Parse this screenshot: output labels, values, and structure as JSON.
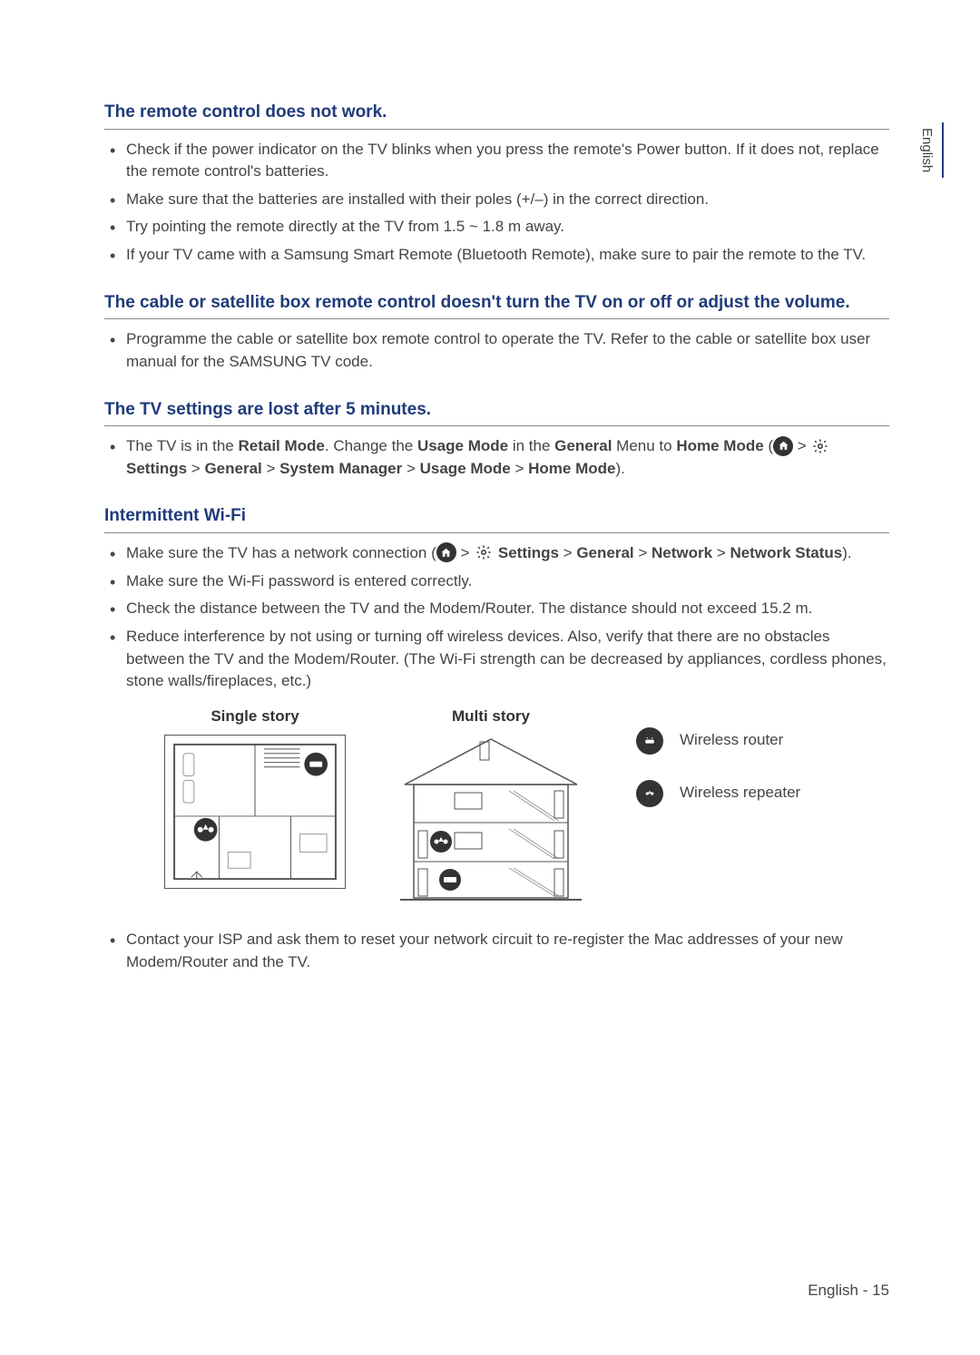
{
  "language_tab": "English",
  "sections": {
    "remote": {
      "title": "The remote control does not work.",
      "items": [
        "Check if the power indicator on the TV blinks when you press the remote's Power button. If it does not, replace the remote control's batteries.",
        "Make sure that the batteries are installed with their poles (+/–) in the correct direction.",
        "Try pointing the remote directly at the TV from 1.5 ~ 1.8 m away.",
        "If your TV came with a Samsung Smart Remote (Bluetooth Remote), make sure to pair the remote to the TV."
      ]
    },
    "cable": {
      "title": "The cable or satellite box remote control doesn't turn the TV on or off or adjust the volume.",
      "items": [
        "Programme the cable or satellite box remote control to operate the TV. Refer to the cable or satellite box user manual for the SAMSUNG TV code."
      ]
    },
    "settings": {
      "title": "The TV settings are lost after 5 minutes.",
      "lead": "The TV is in the ",
      "retail_mode": "Retail Mode",
      "change_the": ". Change the ",
      "usage_mode": "Usage Mode",
      "in_the": " in the ",
      "general": "General",
      "menu_to": " Menu to ",
      "home_mode": "Home Mode",
      "open_paren": " (",
      "sep": " > ",
      "settings_label": "Settings",
      "path2_general": "General",
      "path2_system_manager": "System Manager",
      "path2_usage_mode": "Usage Mode",
      "path2_home_mode": "Home Mode",
      "close_paren": ")."
    },
    "wifi": {
      "title": "Intermittent Wi-Fi",
      "item1_lead": "Make sure the TV has a network connection (",
      "item1_settings": "Settings",
      "item1_general": "General",
      "item1_network": "Network",
      "item1_status": "Network Status",
      "item1_close": ").",
      "items_rest": [
        "Make sure the Wi-Fi password is entered correctly.",
        "Check the distance between the TV and the Modem/Router. The distance should not exceed 15.2 m.",
        "Reduce interference by not using or turning off wireless devices. Also, verify that there are no obstacles between the TV and the Modem/Router. (The Wi-Fi strength can be decreased by appliances, cordless phones, stone walls/fireplaces, etc.)"
      ],
      "diagram": {
        "single": "Single story",
        "multi": "Multi story",
        "legend_router": "Wireless router",
        "legend_repeater": "Wireless repeater"
      },
      "item_last": "Contact your ISP and ask them to reset your network circuit to re-register the Mac addresses of your new Modem/Router and the TV."
    }
  },
  "footer": "English - 15"
}
